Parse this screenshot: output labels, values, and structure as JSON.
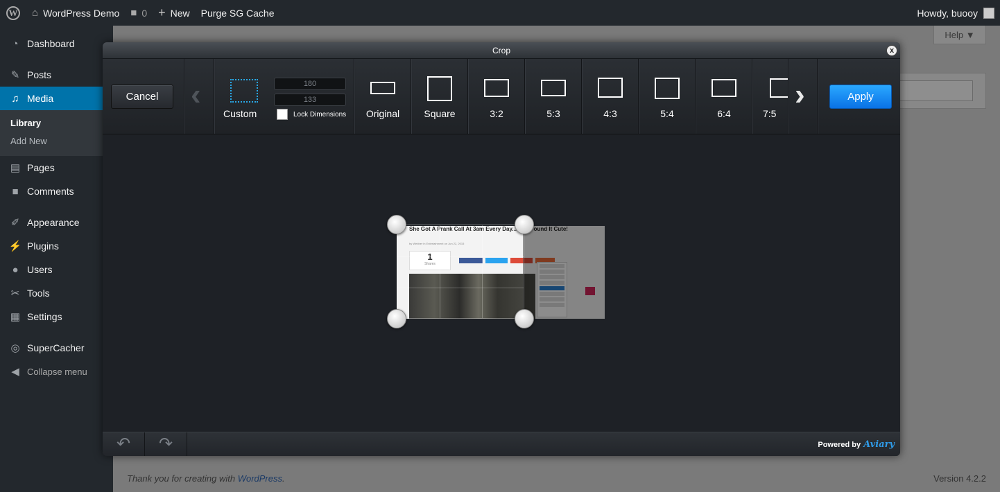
{
  "adminbar": {
    "site_name": "WordPress Demo",
    "comments_count": "0",
    "new_label": "New",
    "purge_label": "Purge SG Cache",
    "howdy": "Howdy, buooy"
  },
  "sidebar": {
    "items": [
      {
        "label": "Dashboard",
        "icon": "dashboard-icon"
      },
      {
        "label": "Posts",
        "icon": "pin-icon"
      },
      {
        "label": "Media",
        "icon": "media-icon"
      },
      {
        "label": "Pages",
        "icon": "page-icon"
      },
      {
        "label": "Comments",
        "icon": "comment-icon"
      },
      {
        "label": "Appearance",
        "icon": "brush-icon"
      },
      {
        "label": "Plugins",
        "icon": "plug-icon"
      },
      {
        "label": "Users",
        "icon": "user-icon"
      },
      {
        "label": "Tools",
        "icon": "wrench-icon"
      },
      {
        "label": "Settings",
        "icon": "settings-icon"
      },
      {
        "label": "SuperCacher",
        "icon": "supercacher-icon"
      }
    ],
    "submenu": [
      "Library",
      "Add New"
    ],
    "collapse_label": "Collapse menu"
  },
  "wpbody": {
    "help_label": "Help ▼",
    "footer_text": "Thank you for creating with ",
    "footer_link": "WordPress",
    "footer_dot": ".",
    "version": "Version 4.2.2"
  },
  "modal": {
    "title": "Crop",
    "close_label": "x",
    "cancel_label": "Cancel",
    "apply_label": "Apply",
    "custom": {
      "label": "Custom",
      "width": "180",
      "height": "133",
      "lock_label": "Lock Dimensions"
    },
    "presets": [
      {
        "label": "Original"
      },
      {
        "label": "Square"
      },
      {
        "label": "3:2"
      },
      {
        "label": "5:3"
      },
      {
        "label": "4:3"
      },
      {
        "label": "5:4"
      },
      {
        "label": "6:4"
      },
      {
        "label": "7:5"
      }
    ],
    "powered_by": "Powered by",
    "brand": "Aviary",
    "accent_color": "#1a8cf0"
  },
  "image": {
    "title": "She Got A Prank Call At 3am Every Day... And Found It Cute!",
    "byline": "by Webber in Entertainment on Jun 22, 2015",
    "shares_count": "1",
    "shares_label": "Shares"
  }
}
